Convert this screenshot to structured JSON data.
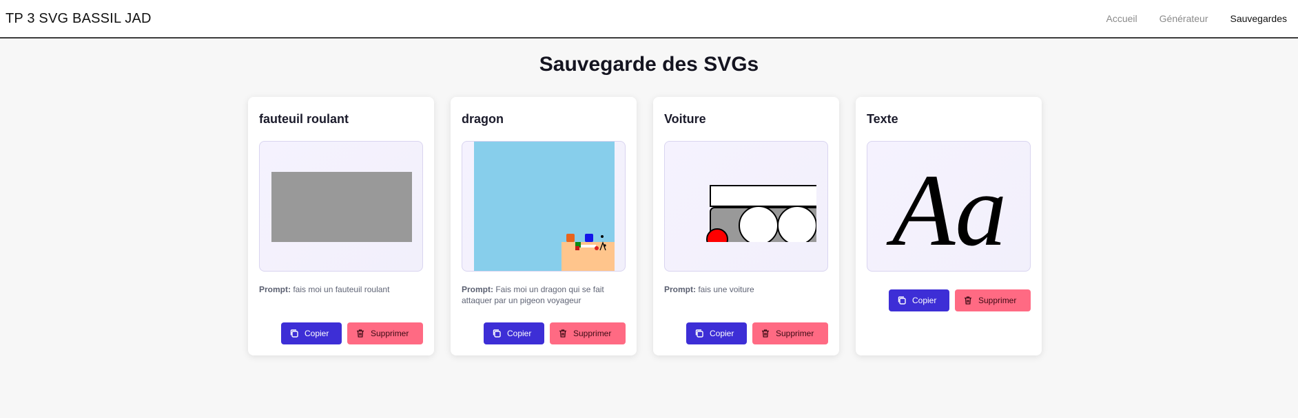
{
  "nav": {
    "brand": "TP 3 SVG BASSIL JAD",
    "links": [
      {
        "label": "Accueil",
        "active": false
      },
      {
        "label": "Générateur",
        "active": false
      },
      {
        "label": "Sauvegardes",
        "active": true
      }
    ]
  },
  "page": {
    "title": "Sauvegarde des SVGs"
  },
  "labels": {
    "prompt_prefix": "Prompt:",
    "copy": "Copier",
    "delete": "Supprimer"
  },
  "cards": [
    {
      "title": "fauteuil roulant",
      "prompt": "fais moi un fauteuil roulant"
    },
    {
      "title": "dragon",
      "prompt": "Fais moi un dragon qui se fait attaquer par un pigeon voyageur"
    },
    {
      "title": "Voiture",
      "prompt": "fais une voiture"
    },
    {
      "title": "Texte",
      "prompt": "",
      "preview_text": "Aa"
    }
  ],
  "colors": {
    "primary_button": "#3d2ed6",
    "danger_button": "#ff6a83",
    "sky": "#87ceeb",
    "sand": "#ffc58c"
  },
  "icons": {
    "copy": "copy-icon",
    "delete": "trash-icon"
  }
}
